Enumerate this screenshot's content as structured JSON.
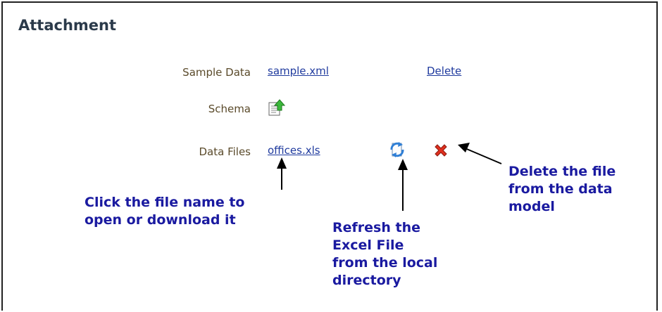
{
  "section": {
    "title": "Attachment"
  },
  "rows": {
    "sample_data": {
      "label": "Sample Data",
      "file": "sample.xml",
      "action": "Delete"
    },
    "schema": {
      "label": "Schema",
      "icon": "upload-icon"
    },
    "data_files": {
      "label": "Data Files",
      "file": "offices.xls",
      "refresh_icon": "refresh-icon",
      "delete_icon": "delete-x-icon"
    }
  },
  "callouts": {
    "file_name": [
      "Click the file name to",
      "open or download it"
    ],
    "refresh": [
      "Refresh the",
      "Excel File",
      "from the local",
      "directory"
    ],
    "delete": [
      "Delete the file",
      "from the data",
      "model"
    ]
  },
  "colors": {
    "link": "#1f3a9e",
    "callout": "#1a1aa0",
    "label": "#5a4a2a",
    "delete_icon": "#e0301e"
  }
}
